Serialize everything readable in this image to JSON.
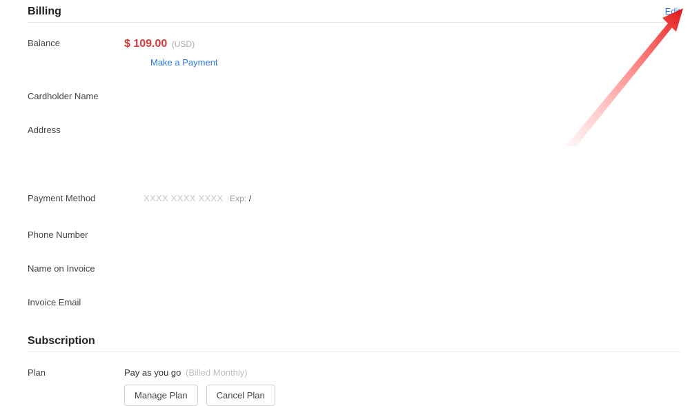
{
  "billing": {
    "title": "Billing",
    "edit_label": "Edit",
    "balance_label": "Balance",
    "balance_symbol": "$",
    "balance_amount": "109.00",
    "balance_currency": "(USD)",
    "make_payment_label": "Make a Payment",
    "cardholder_label": "Cardholder Name",
    "cardholder_value": "",
    "address_label": "Address",
    "address_value": "",
    "payment_method_label": "Payment Method",
    "card_mask": "XXXX XXXX XXXX",
    "exp_label": "Exp:",
    "exp_value": "/",
    "phone_label": "Phone Number",
    "phone_value": "",
    "name_invoice_label": "Name on Invoice",
    "name_invoice_value": "",
    "invoice_email_label": "Invoice Email",
    "invoice_email_value": ""
  },
  "subscription": {
    "title": "Subscription",
    "plan_label": "Plan",
    "plan_name": "Pay as you go",
    "plan_billing": "(Billed Monthly)",
    "manage_label": "Manage Plan",
    "cancel_label": "Cancel Plan"
  }
}
